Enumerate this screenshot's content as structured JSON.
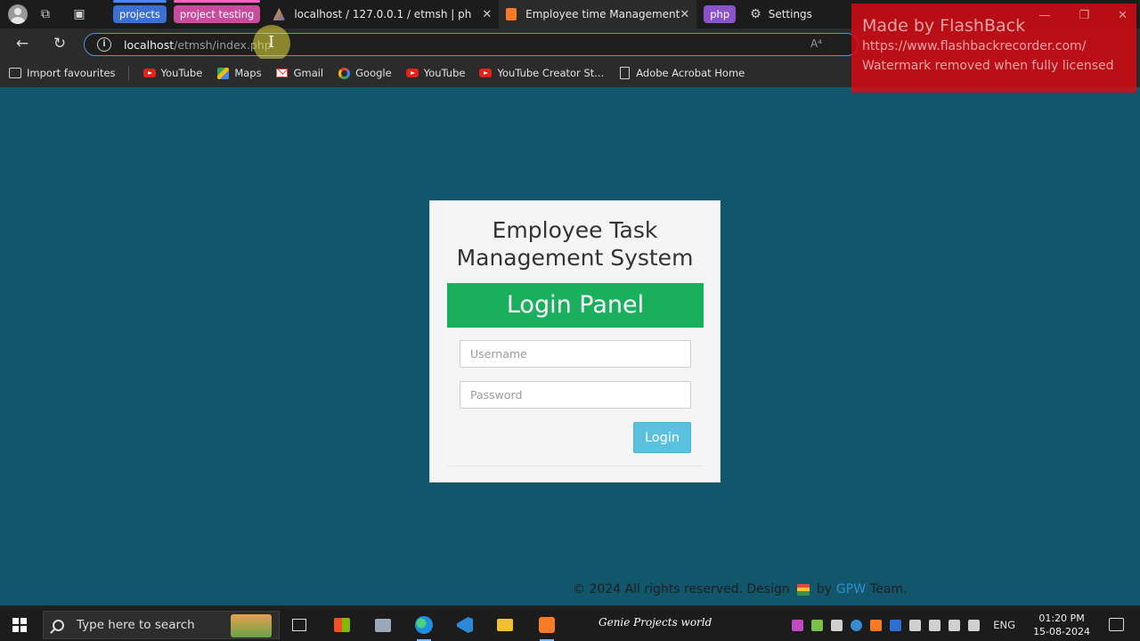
{
  "browser": {
    "tab_groups": [
      {
        "label": "projects"
      },
      {
        "label": "project testing"
      },
      {
        "label": "php"
      }
    ],
    "tabs": [
      {
        "title": "localhost / 127.0.0.1 / etmsh | ph"
      },
      {
        "title": "Employee time Management"
      }
    ],
    "settings_tab": "Settings",
    "address": {
      "host": "localhost",
      "path": "/etmsh/index.php"
    },
    "bookmarks": [
      {
        "label": "Import favourites",
        "icon": "import-icon"
      },
      {
        "label": "YouTube",
        "icon": "youtube-icon"
      },
      {
        "label": "Maps",
        "icon": "maps-icon"
      },
      {
        "label": "Gmail",
        "icon": "gmail-icon"
      },
      {
        "label": "Google",
        "icon": "google-icon"
      },
      {
        "label": "YouTube",
        "icon": "youtube-icon"
      },
      {
        "label": "YouTube Creator St...",
        "icon": "youtube-icon"
      },
      {
        "label": "Adobe Acrobat Home",
        "icon": "document-icon"
      }
    ]
  },
  "watermark": {
    "line1": "Made by FlashBack",
    "line2": "https://www.flashbackrecorder.com/",
    "line3": "Watermark removed when fully licensed"
  },
  "login": {
    "app_title_line1": "Employee Task",
    "app_title_line2": "Management System",
    "panel_heading": "Login Panel",
    "username_placeholder": "Username",
    "password_placeholder": "Password",
    "login_button": "Login"
  },
  "footer": {
    "prefix": "© 2024 All rights reserved. Design",
    "by": "by",
    "brand": "GPW",
    "suffix": "Team."
  },
  "taskbar": {
    "search_placeholder": "Type here to search",
    "promo_text": "Genie Projects world",
    "language": "ENG",
    "time": "01:20 PM",
    "date": "15-08-2024"
  },
  "colors": {
    "page_background": "#11566b",
    "panel_heading": "#1aaf5d",
    "login_button": "#5bc0de",
    "watermark": "#dc0a14"
  }
}
